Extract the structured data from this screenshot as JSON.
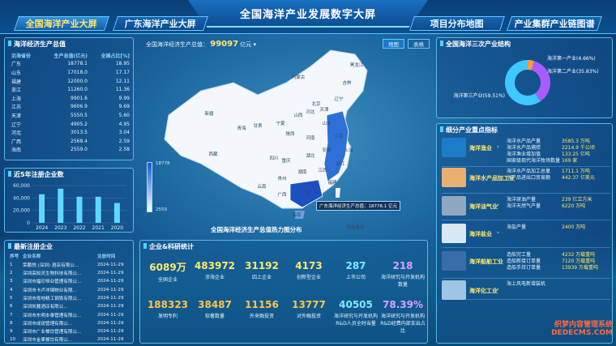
{
  "header": {
    "title": "全国海洋产业发展数字大屏",
    "nav": [
      "全国海洋产业大屏",
      "广东海洋产业大屏",
      "项目分布地图",
      "产业集群产业链图谱"
    ]
  },
  "gdp_panel": {
    "title": "海洋经济生产总值",
    "headers": [
      "沿海省份",
      "生产总值(亿元)",
      "全国占比[%]"
    ],
    "rows": [
      [
        "广东",
        "18778.1",
        "18.95"
      ],
      [
        "山东",
        "17018.0",
        "17.17"
      ],
      [
        "福建",
        "12000.0",
        "12.11"
      ],
      [
        "浙江",
        "11260.0",
        "11.36"
      ],
      [
        "上海",
        "9901.6",
        "9.99"
      ],
      [
        "江苏",
        "9606.9",
        "9.69"
      ],
      [
        "天津",
        "5550.5",
        "5.60"
      ],
      [
        "辽宁",
        "4905.2",
        "4.95"
      ],
      [
        "河北",
        "3013.5",
        "3.04"
      ],
      [
        "广西",
        "2568.4",
        "2.59"
      ],
      [
        "海南",
        "2559.0",
        "2.58"
      ]
    ]
  },
  "recent_panel": {
    "title": "近5年注册企业数",
    "chart_data": {
      "type": "bar",
      "categories": [
        "2024",
        "2023",
        "2022",
        "2021",
        "2020"
      ],
      "values": [
        46000,
        55000,
        42000,
        42000,
        32000
      ],
      "ylim": [
        0,
        60000
      ],
      "yticks": [
        "60,000",
        "40,000",
        "20,000",
        "0"
      ]
    }
  },
  "new_panel": {
    "title": "最新注册企业",
    "headers": [
      "序号",
      "企业名称",
      "注册时间"
    ],
    "rows": [
      [
        "1",
        "荣鹏悦 (深圳) 酒店有限公...",
        "2024-11-29"
      ],
      [
        "2",
        "深圳高知灵生物科技有限公...",
        "2024-11-29"
      ],
      [
        "3",
        "深圳市福印恒业管理有限公...",
        "2024-11-29"
      ],
      [
        "4",
        "深圳市卡卢冲钢物业有限...",
        "2024-11-29"
      ],
      [
        "5",
        "深圳市粤地精工钢铁有限公...",
        "2024-11-29"
      ],
      [
        "6",
        "深圳凯麓酒店有限公...",
        "2024-11-29"
      ],
      [
        "7",
        "深圳市东明本泰管理有限公...",
        "2024-11-29"
      ],
      [
        "8",
        "深圳市成锐管理有限公...",
        "2024-11-29"
      ],
      [
        "9",
        "深圳市广业餐饮管理有限公...",
        "2024-11-29"
      ],
      [
        "10",
        "深圳市金果餐饮有限公...",
        "2024-11-29"
      ]
    ]
  },
  "map": {
    "gdp_label": "全国海洋经济生产总值：",
    "gdp_value": "99097",
    "gdp_unit": "亿元",
    "toggle_map": "地图",
    "toggle_table": "表格",
    "legend_max": "18778",
    "legend_min": "2559",
    "caption": "全国海洋经济生产总值热力图分布",
    "tooltip": "广东海洋经济生产总值：18778.1 亿元",
    "provinces": [
      "黑龙江",
      "吉林",
      "辽宁",
      "内蒙古",
      "新疆",
      "北京",
      "天津",
      "河北",
      "山西",
      "山东",
      "宁夏",
      "甘肃",
      "青海",
      "陕西",
      "河南",
      "江苏",
      "西藏",
      "四川",
      "湖北",
      "安徽",
      "上海",
      "重庆",
      "湖南",
      "江西",
      "浙江",
      "贵州",
      "云南",
      "福建",
      "广西",
      "广东",
      "海南",
      "台湾",
      "南海诸岛"
    ]
  },
  "stats": {
    "title": "企业&科研统计",
    "items": [
      {
        "n": "6089万",
        "l": "全国企业",
        "c": "#ffe86a"
      },
      {
        "n": "483972",
        "l": "涉海企业",
        "c": "#ffe86a"
      },
      {
        "n": "31192",
        "l": "四上企业",
        "c": "#ffe86a"
      },
      {
        "n": "4173",
        "l": "创新型企业",
        "c": "#ffe86a"
      },
      {
        "n": "287",
        "l": "上市公司",
        "c": "#7fe8ff"
      },
      {
        "n": "218",
        "l": "海洋研究与开发机构数量",
        "c": "#d6a0ff"
      },
      {
        "n": "188323",
        "l": "发明专利",
        "c": "#ffc44a"
      },
      {
        "n": "38487",
        "l": "软著数量",
        "c": "#ffc44a"
      },
      {
        "n": "11156",
        "l": "外来融投资",
        "c": "#ffc44a"
      },
      {
        "n": "13777",
        "l": "对外融投资",
        "c": "#ffc44a"
      },
      {
        "n": "40505",
        "l": "海洋研究与开发机构R&D人员全时当量",
        "c": "#7fe8ff"
      },
      {
        "n": "78.39%",
        "l": "海洋研究与开发机构R&D经费内部支出占比",
        "c": "#d6a0ff"
      }
    ]
  },
  "structure": {
    "title": "全国海洋三次产业结构",
    "chart_data": {
      "type": "pie",
      "labels": [
        "海洋第一产业",
        "海洋第二产业",
        "海洋第三产业"
      ],
      "values": [
        4.66,
        35.83,
        59.51
      ],
      "colors": [
        "#ff9b3d",
        "#a85cff",
        "#3fc8ff"
      ],
      "label_texts": [
        "海洋第一产业(4.66%)",
        "海洋第二产业(35.83%)",
        "海洋第三产业(59.51%)"
      ]
    }
  },
  "industries": {
    "title": "细分产业重点指标",
    "rows": [
      {
        "name": "海洋渔业",
        "items": [
          "海洋水产品产量",
          "海洋水产品捕捞",
          "海洋渔业增加值",
          "国家级现代海洋牧场数量"
        ],
        "vals": [
          "3585.3 万吨",
          "2214.9 千公顷",
          "133.25 亿吨",
          "169 家"
        ]
      },
      {
        "name": "海洋水产品加工业",
        "items": [
          "海洋水产品加工总量",
          "水产品进出口贸易额"
        ],
        "vals": [
          "1711.1 万吨",
          "442.37 亿美元"
        ]
      },
      {
        "name": "海洋油气业",
        "items": [
          "海洋原油产量",
          "海洋天然气产量"
        ],
        "vals": [
          "239 亿立方米",
          "6220 万吨"
        ]
      },
      {
        "name": "海洋盐业",
        "items": [
          "海盐产量"
        ],
        "vals": [
          "2400 万吨"
        ]
      },
      {
        "name": "海洋船舶工业",
        "items": [
          "造船完工量",
          "造船新接订单量",
          "造船手持订单量"
        ],
        "vals": [
          "4232 万载重吨",
          "7120 万载重吨",
          "13939 万载重吨"
        ]
      },
      {
        "name": "海洋化工业",
        "items": [
          "海上风电新增装机"
        ],
        "vals": [
          ""
        ]
      }
    ]
  },
  "watermark": "织梦内容管理系统 DEDECMS.COM"
}
